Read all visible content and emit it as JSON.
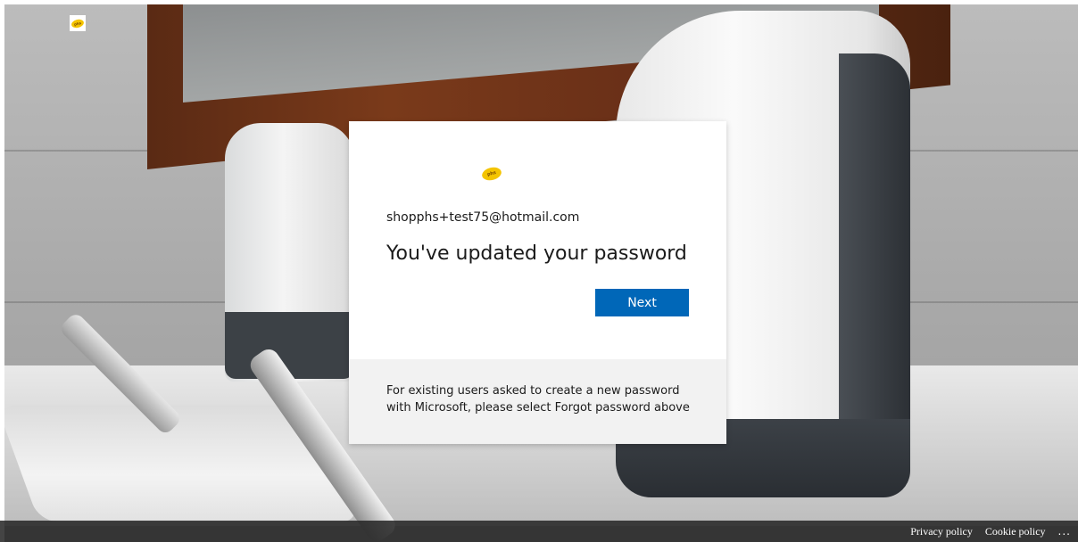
{
  "branding": {
    "logo_text": "phs",
    "brand_color": "#f4c400"
  },
  "dialog": {
    "account_email": "shopphs+test75@hotmail.com",
    "title": "You've updated your password",
    "next_label": "Next",
    "next_color": "#0067b8",
    "footer_message": "For existing users asked to create a new password with Microsoft, please select Forgot password above"
  },
  "footer": {
    "privacy_label": "Privacy policy",
    "cookie_label": "Cookie policy",
    "more_label": "..."
  }
}
